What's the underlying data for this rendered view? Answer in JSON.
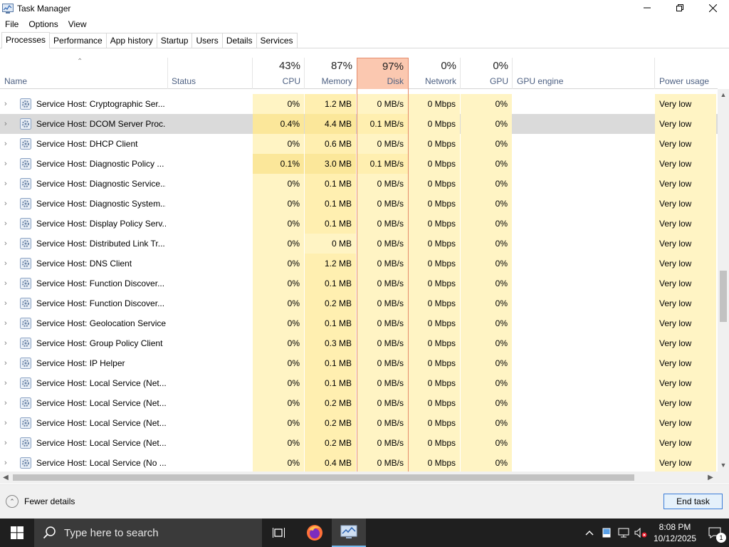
{
  "window": {
    "title": "Task Manager"
  },
  "menu": [
    "File",
    "Options",
    "View"
  ],
  "tabs": [
    "Processes",
    "Performance",
    "App history",
    "Startup",
    "Users",
    "Details",
    "Services"
  ],
  "columns": {
    "name": "Name",
    "status": "Status",
    "cpu": {
      "pct": "43%",
      "label": "CPU"
    },
    "memory": {
      "pct": "87%",
      "label": "Memory"
    },
    "disk": {
      "pct": "97%",
      "label": "Disk"
    },
    "network": {
      "pct": "0%",
      "label": "Network"
    },
    "gpu": {
      "pct": "0%",
      "label": "GPU"
    },
    "gpu_engine": "GPU engine",
    "power": "Power usage"
  },
  "processes": [
    {
      "name": "Service Host: Cryptographic Ser...",
      "cpu": "0%",
      "memory": "1.2 MB",
      "disk": "0 MB/s",
      "network": "0 Mbps",
      "gpu": "0%",
      "power": "Very low"
    },
    {
      "name": "Service Host: DCOM Server Proc...",
      "cpu": "0.4%",
      "memory": "4.4 MB",
      "disk": "0.1 MB/s",
      "network": "0 Mbps",
      "gpu": "0%",
      "power": "Very low"
    },
    {
      "name": "Service Host: DHCP Client",
      "cpu": "0%",
      "memory": "0.6 MB",
      "disk": "0 MB/s",
      "network": "0 Mbps",
      "gpu": "0%",
      "power": "Very low"
    },
    {
      "name": "Service Host: Diagnostic Policy ...",
      "cpu": "0.1%",
      "memory": "3.0 MB",
      "disk": "0.1 MB/s",
      "network": "0 Mbps",
      "gpu": "0%",
      "power": "Very low"
    },
    {
      "name": "Service Host: Diagnostic Service...",
      "cpu": "0%",
      "memory": "0.1 MB",
      "disk": "0 MB/s",
      "network": "0 Mbps",
      "gpu": "0%",
      "power": "Very low"
    },
    {
      "name": "Service Host: Diagnostic System...",
      "cpu": "0%",
      "memory": "0.1 MB",
      "disk": "0 MB/s",
      "network": "0 Mbps",
      "gpu": "0%",
      "power": "Very low"
    },
    {
      "name": "Service Host: Display Policy Serv...",
      "cpu": "0%",
      "memory": "0.1 MB",
      "disk": "0 MB/s",
      "network": "0 Mbps",
      "gpu": "0%",
      "power": "Very low"
    },
    {
      "name": "Service Host: Distributed Link Tr...",
      "cpu": "0%",
      "memory": "0 MB",
      "disk": "0 MB/s",
      "network": "0 Mbps",
      "gpu": "0%",
      "power": "Very low"
    },
    {
      "name": "Service Host: DNS Client",
      "cpu": "0%",
      "memory": "1.2 MB",
      "disk": "0 MB/s",
      "network": "0 Mbps",
      "gpu": "0%",
      "power": "Very low"
    },
    {
      "name": "Service Host: Function Discover...",
      "cpu": "0%",
      "memory": "0.1 MB",
      "disk": "0 MB/s",
      "network": "0 Mbps",
      "gpu": "0%",
      "power": "Very low"
    },
    {
      "name": "Service Host: Function Discover...",
      "cpu": "0%",
      "memory": "0.2 MB",
      "disk": "0 MB/s",
      "network": "0 Mbps",
      "gpu": "0%",
      "power": "Very low"
    },
    {
      "name": "Service Host: Geolocation Service",
      "cpu": "0%",
      "memory": "0.1 MB",
      "disk": "0 MB/s",
      "network": "0 Mbps",
      "gpu": "0%",
      "power": "Very low"
    },
    {
      "name": "Service Host: Group Policy Client",
      "cpu": "0%",
      "memory": "0.3 MB",
      "disk": "0 MB/s",
      "network": "0 Mbps",
      "gpu": "0%",
      "power": "Very low"
    },
    {
      "name": "Service Host: IP Helper",
      "cpu": "0%",
      "memory": "0.1 MB",
      "disk": "0 MB/s",
      "network": "0 Mbps",
      "gpu": "0%",
      "power": "Very low"
    },
    {
      "name": "Service Host: Local Service (Net...",
      "cpu": "0%",
      "memory": "0.1 MB",
      "disk": "0 MB/s",
      "network": "0 Mbps",
      "gpu": "0%",
      "power": "Very low"
    },
    {
      "name": "Service Host: Local Service (Net...",
      "cpu": "0%",
      "memory": "0.2 MB",
      "disk": "0 MB/s",
      "network": "0 Mbps",
      "gpu": "0%",
      "power": "Very low"
    },
    {
      "name": "Service Host: Local Service (Net...",
      "cpu": "0%",
      "memory": "0.2 MB",
      "disk": "0 MB/s",
      "network": "0 Mbps",
      "gpu": "0%",
      "power": "Very low"
    },
    {
      "name": "Service Host: Local Service (Net...",
      "cpu": "0%",
      "memory": "0.2 MB",
      "disk": "0 MB/s",
      "network": "0 Mbps",
      "gpu": "0%",
      "power": "Very low"
    },
    {
      "name": "Service Host: Local Service (No ...",
      "cpu": "0%",
      "memory": "0.4 MB",
      "disk": "0 MB/s",
      "network": "0 Mbps",
      "gpu": "0%",
      "power": "Very low"
    }
  ],
  "footer": {
    "fewer_details": "Fewer details",
    "end_task": "End task"
  },
  "taskbar": {
    "search_placeholder": "Type here to search",
    "time": "8:08 PM",
    "date": "10/12/2025",
    "notification_count": "1"
  },
  "colors": {
    "disk_header": "#fbc8b0",
    "heat_light": "#fff4c4",
    "heat_mid": "#ffefb0",
    "heat_strong": "#fbe79a",
    "accent": "#3b7dd8"
  }
}
